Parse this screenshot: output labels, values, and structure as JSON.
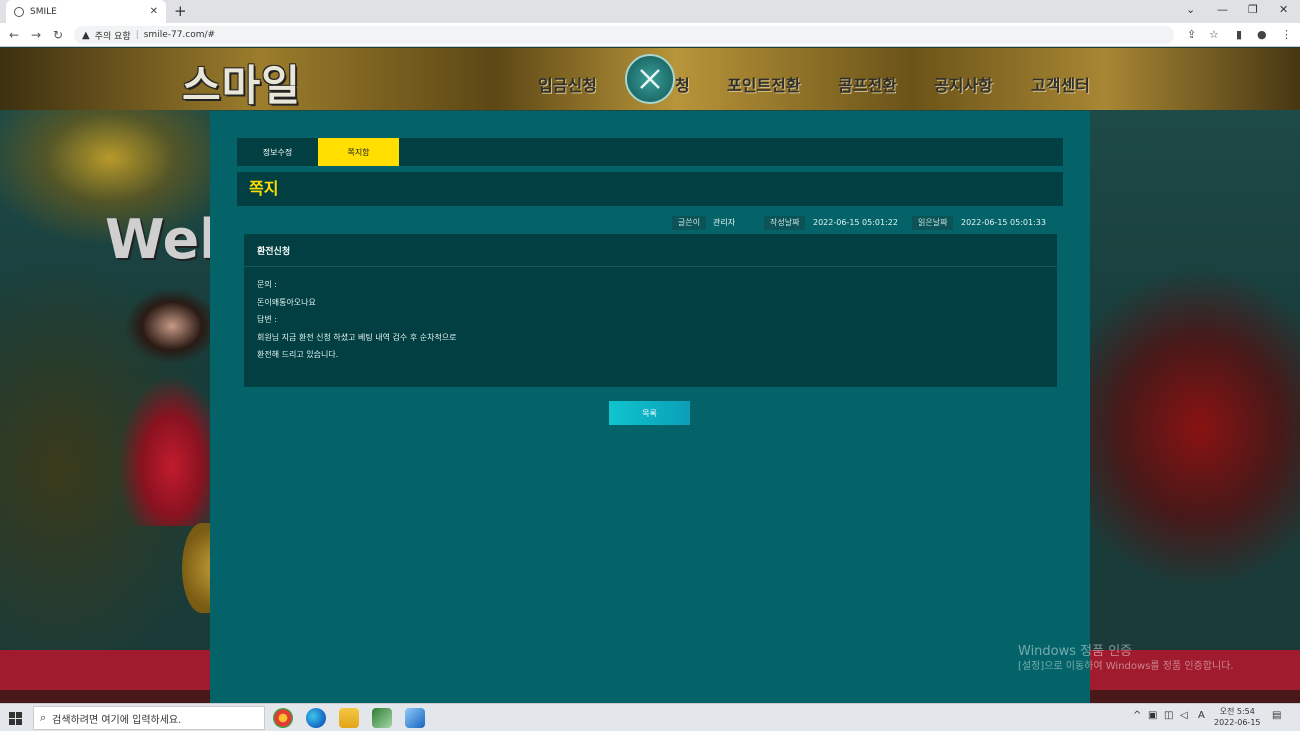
{
  "browser": {
    "tab_title": "SMILE",
    "tab_close": "✕",
    "new_tab": "+",
    "security_label": "주의 요함",
    "url": "smile-77.com/#"
  },
  "site": {
    "logo": "스마일",
    "menu": [
      "입금신청",
      "청",
      "포인트전환",
      "콤프전환",
      "공지사항",
      "고객센터"
    ],
    "welcome_text": "Welc"
  },
  "panel": {
    "tabs": [
      "정보수정",
      "쪽지함"
    ],
    "active_tab": 1,
    "heading": "쪽지",
    "meta": {
      "author_label": "글쓴이",
      "author": "관리자",
      "written_label": "작성날짜",
      "written": "2022-06-15 05:01:22",
      "read_label": "읽은날짜",
      "read": "2022-06-15 05:01:33"
    },
    "message": {
      "title": "환전신청",
      "lines": [
        "문의 :",
        "돈이왜통아오나요",
        "답변 :",
        "회원님 지금 환전 신청 하셨고 베팅 내역 검수 후 순차적으로",
        "환전해 드리고 있습니다."
      ]
    },
    "list_button": "목록"
  },
  "watermark": {
    "line1": "Windows 정품 인증",
    "line2": "[설정]으로 이동하여 Windows를 정품 인증합니다."
  },
  "taskbar": {
    "search_placeholder": "검색하려면 여기에 입력하세요.",
    "time": "오전 5:54",
    "date": "2022-06-15",
    "ime": "A"
  },
  "colors": {
    "panel": "#036368",
    "dark_panel": "#013f42",
    "accent_yellow": "#ffde00",
    "button_cyan": "#10c4cd"
  }
}
